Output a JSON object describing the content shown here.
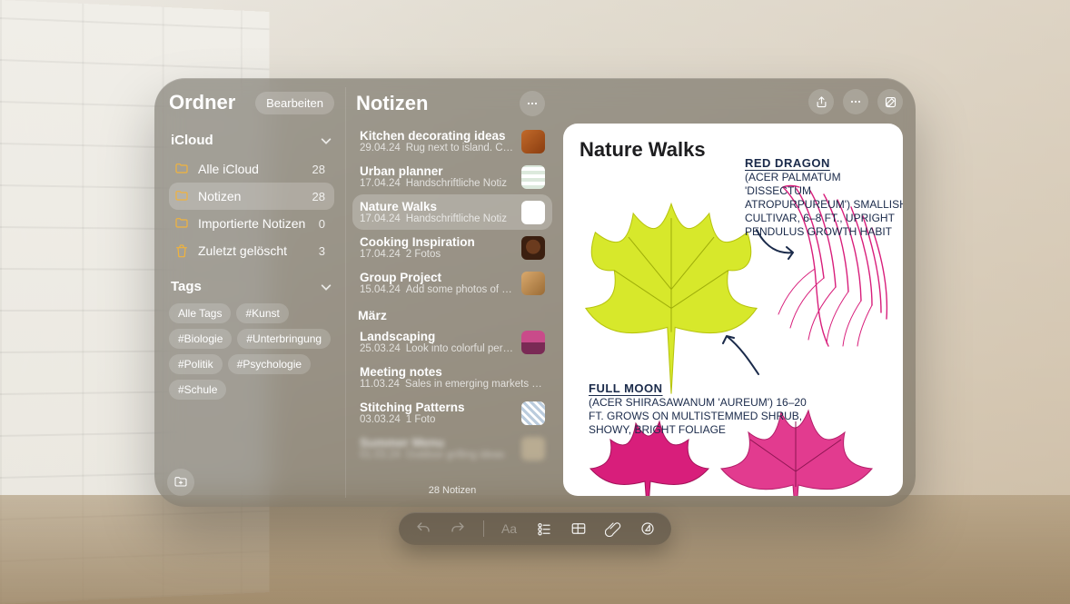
{
  "sidebar": {
    "title": "Ordner",
    "edit_label": "Bearbeiten",
    "sections": {
      "icloud": {
        "label": "iCloud"
      },
      "tags": {
        "label": "Tags"
      }
    },
    "folders": [
      {
        "icon": "folder",
        "label": "Alle iCloud",
        "count": "28"
      },
      {
        "icon": "folder",
        "label": "Notizen",
        "count": "28",
        "selected": true
      },
      {
        "icon": "folder",
        "label": "Importierte Notizen",
        "count": "0"
      },
      {
        "icon": "trash",
        "label": "Zuletzt gelöscht",
        "count": "3"
      }
    ],
    "tags": [
      "Alle Tags",
      "#Kunst",
      "#Biologie",
      "#Unterbringung",
      "#Politik",
      "#Psychologie",
      "#Schule"
    ]
  },
  "notes_column": {
    "title": "Notizen",
    "count_label": "28 Notizen",
    "groups": [
      {
        "heading": null,
        "items": [
          {
            "title": "Kitchen decorating ideas",
            "date": "29.04.24",
            "snippet": "Rug next to island. Cont…",
            "thumb": "th-orange"
          },
          {
            "title": "Urban planner",
            "date": "17.04.24",
            "snippet": "Handschriftliche Notiz",
            "thumb": "th-grid"
          },
          {
            "title": "Nature Walks",
            "date": "17.04.24",
            "snippet": "Handschriftliche Notiz",
            "thumb": "th-nature",
            "selected": true
          },
          {
            "title": "Cooking Inspiration",
            "date": "17.04.24",
            "snippet": "2 Fotos",
            "thumb": "th-cocoa"
          },
          {
            "title": "Group Project",
            "date": "15.04.24",
            "snippet": "Add some photos of thei…",
            "thumb": "th-group"
          }
        ]
      },
      {
        "heading": "März",
        "items": [
          {
            "title": "Landscaping",
            "date": "25.03.24",
            "snippet": "Look into colorful peren…",
            "thumb": "th-land"
          },
          {
            "title": "Meeting notes",
            "date": "11.03.24",
            "snippet": "Sales in emerging markets are tr…",
            "thumb": null
          },
          {
            "title": "Stitching Patterns",
            "date": "03.03.24",
            "snippet": "1 Foto",
            "thumb": "th-stitch"
          },
          {
            "title": "Summer Menu",
            "date": "01.03.24",
            "snippet": "Outdoor grilling ideas",
            "thumb": "th-blur",
            "blur": true
          }
        ]
      }
    ]
  },
  "document": {
    "title": "Nature Walks",
    "annot1_heading": "RED DRAGON",
    "annot1_body": "(ACER PALMATUM 'DISSECTUM ATROPURPUREUM') SMALLISH CULTIVAR, 6–8 FT., UPRIGHT PENDULUS GROWTH HABIT",
    "annot2_heading": "FULL MOON",
    "annot2_body": "(ACER SHIRASAWANUM 'AUREUM') 16–20 FT. GROWS ON MULTISTEMMED SHRUB, SHOWY, BRIGHT FOLIAGE"
  },
  "toolbar": {
    "format_label": "Aa"
  },
  "colors": {
    "accent_yellow": "#f1b33c",
    "leaf_green": "#d7e82b",
    "leaf_magenta": "#d81e7b"
  }
}
